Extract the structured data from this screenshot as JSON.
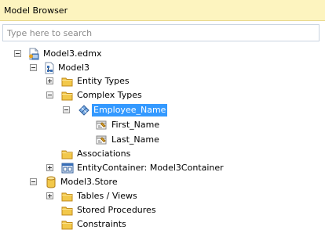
{
  "panel": {
    "title": "Model Browser"
  },
  "search": {
    "placeholder": "Type here to search"
  },
  "tree": {
    "edmx": "Model3.edmx",
    "model": "Model3",
    "entity_types": "Entity Types",
    "complex_types": "Complex Types",
    "employee_name": "Employee_Name",
    "first_name": "First_Name",
    "last_name": "Last_Name",
    "associations": "Associations",
    "entity_container": "EntityContainer: Model3Container",
    "store": "Model3.Store",
    "tables_views": "Tables / Views",
    "stored_procedures": "Stored Procedures",
    "constraints": "Constraints"
  },
  "colors": {
    "title_bar": "#fdf4bf",
    "selection": "#3399ff",
    "folder": "#f2c84a"
  },
  "icons": {
    "edmx": "edmx-file-icon",
    "model": "model-icon",
    "folder": "folder-icon",
    "complex": "complex-type-icon",
    "property": "property-icon",
    "container": "entity-container-icon",
    "database": "database-icon"
  }
}
